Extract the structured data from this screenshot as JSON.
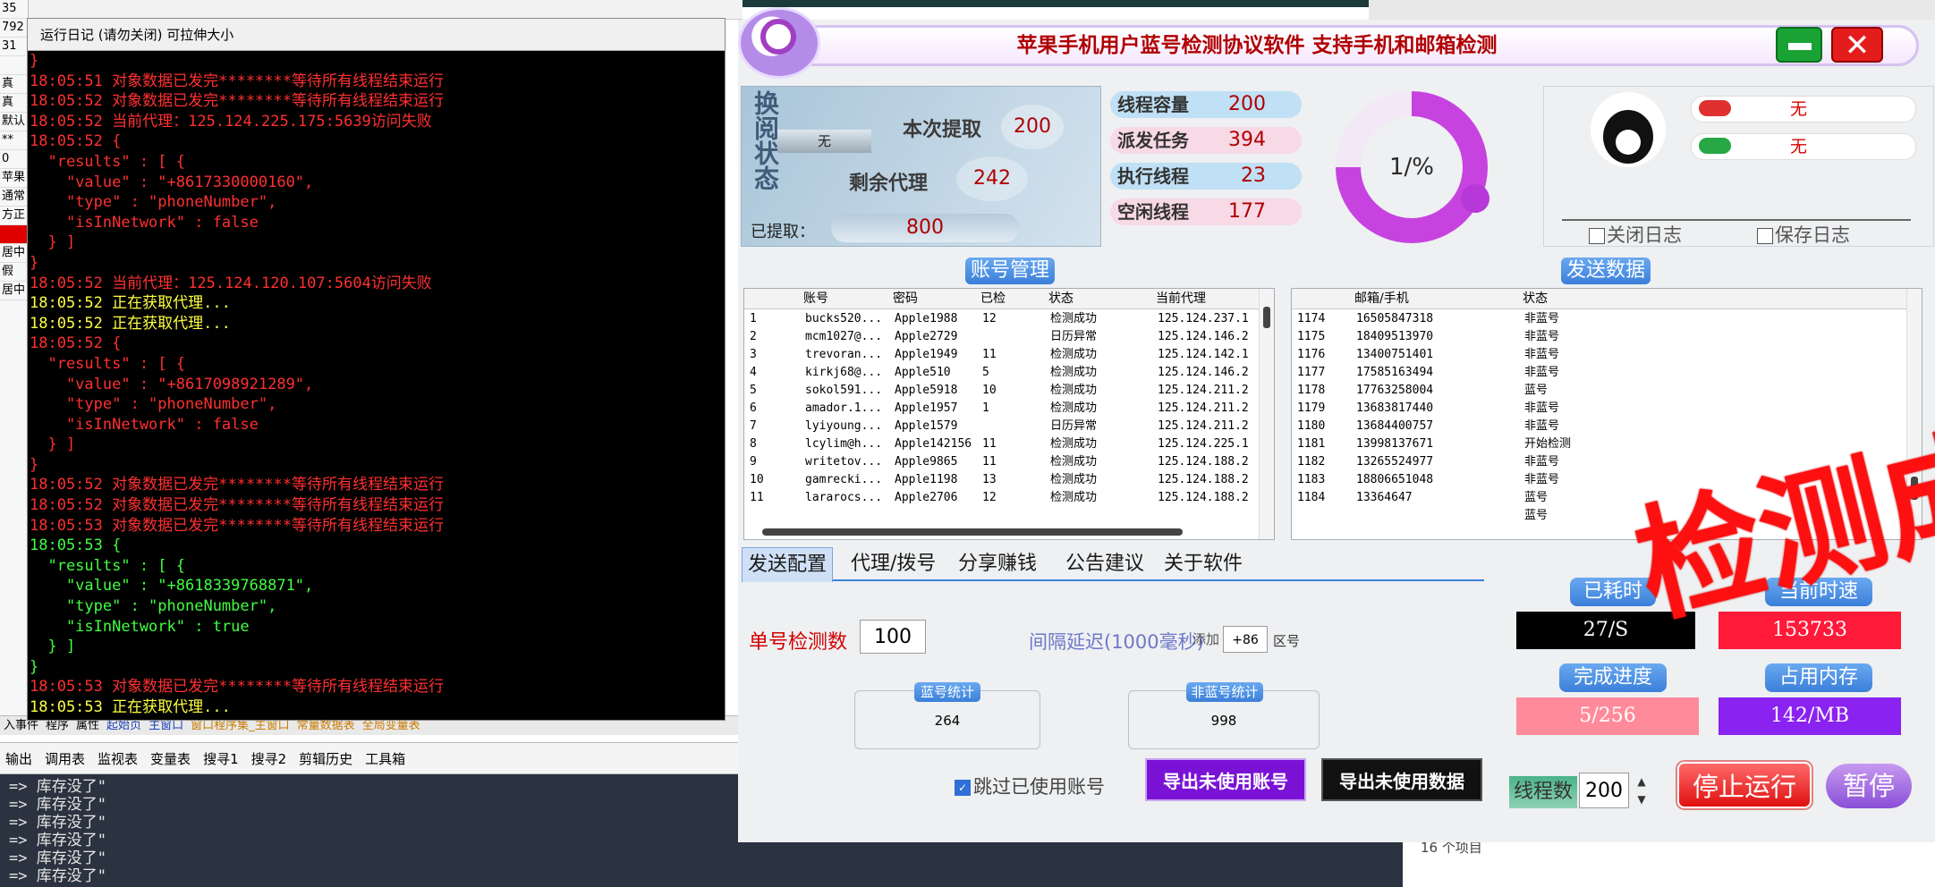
{
  "ide": {
    "left_col": [
      "35",
      "792",
      "31",
      "",
      "真",
      "真",
      "默认",
      "**",
      "0",
      "苹果",
      "通常",
      "方正",
      "",
      "居中",
      "假",
      "居中"
    ],
    "tabs": [
      "入事件",
      "程序",
      "属性",
      "起始页",
      "主窗口",
      "窗口程序集_主窗口",
      "常量数据表",
      "全局变量表"
    ],
    "toolbar": [
      "输出",
      "调用表",
      "监视表",
      "变量表",
      "搜寻1",
      "搜寻2",
      "剪辑历史",
      "工具箱"
    ],
    "output_lines": [
      "=> 库存没了\"",
      "=> 库存没了\"",
      "=> 库存没了\"",
      "=> 库存没了\"",
      "=> 库存没了\"",
      "=> 库存没了\""
    ],
    "file_count": "16 个项目"
  },
  "log_window": {
    "title": "运行日记 (请勿关闭) 可拉伸大小",
    "lines": [
      {
        "text": "}",
        "color": "red"
      },
      {
        "text": "18:05:51 对象数据已发完********等待所有线程结束运行",
        "color": "red"
      },
      {
        "text": "18:05:52 对象数据已发完********等待所有线程结束运行",
        "color": "red"
      },
      {
        "text": "18:05:52 当前代理：125.124.225.175:5639访问失败",
        "color": "red"
      },
      {
        "text": "18:05:52 {",
        "color": "red"
      },
      {
        "text": "  \"results\" : [ {",
        "color": "red"
      },
      {
        "text": "    \"value\" : \"+8617330000160\",",
        "color": "red"
      },
      {
        "text": "    \"type\" : \"phoneNumber\",",
        "color": "red"
      },
      {
        "text": "    \"isInNetwork\" : false",
        "color": "red"
      },
      {
        "text": "  } ]",
        "color": "red"
      },
      {
        "text": "}",
        "color": "red"
      },
      {
        "text": "18:05:52 当前代理：125.124.120.107:5604访问失败",
        "color": "red"
      },
      {
        "text": "18:05:52 正在获取代理...",
        "color": "yellow"
      },
      {
        "text": "18:05:52 正在获取代理...",
        "color": "yellow"
      },
      {
        "text": "18:05:52 {",
        "color": "red"
      },
      {
        "text": "  \"results\" : [ {",
        "color": "red"
      },
      {
        "text": "    \"value\" : \"+8617098921289\",",
        "color": "red"
      },
      {
        "text": "    \"type\" : \"phoneNumber\",",
        "color": "red"
      },
      {
        "text": "    \"isInNetwork\" : false",
        "color": "red"
      },
      {
        "text": "  } ]",
        "color": "red"
      },
      {
        "text": "}",
        "color": "red"
      },
      {
        "text": "18:05:52 对象数据已发完********等待所有线程结束运行",
        "color": "red"
      },
      {
        "text": "18:05:52 对象数据已发完********等待所有线程结束运行",
        "color": "red"
      },
      {
        "text": "18:05:53 对象数据已发完********等待所有线程结束运行",
        "color": "red"
      },
      {
        "text": "18:05:53 {",
        "color": "green"
      },
      {
        "text": "  \"results\" : [ {",
        "color": "green"
      },
      {
        "text": "    \"value\" : \"+8618339768871\",",
        "color": "green"
      },
      {
        "text": "    \"type\" : \"phoneNumber\",",
        "color": "green"
      },
      {
        "text": "    \"isInNetwork\" : true",
        "color": "green"
      },
      {
        "text": "  } ]",
        "color": "green"
      },
      {
        "text": "}",
        "color": "green"
      },
      {
        "text": "18:05:53 对象数据已发完********等待所有线程结束运行",
        "color": "red"
      },
      {
        "text": "18:05:53 正在获取代理...",
        "color": "yellow"
      }
    ]
  },
  "app": {
    "title": "苹果手机用户蓝号检测协议软件 支持手机和邮箱检测",
    "status_vertical": "换阅状态",
    "status_value": "无",
    "fetch_label": "本次提取",
    "fetch_value": "200",
    "proxy_label": "剩余代理",
    "proxy_value": "242",
    "extracted_label": "已提取：",
    "extracted_value": "800",
    "threads": [
      {
        "label": "线程容量",
        "value": "200",
        "color": "#bfe0f5"
      },
      {
        "label": "派发任务",
        "value": "394",
        "color": "#f8d9e6"
      },
      {
        "label": "执行线程",
        "value": "23",
        "color": "#bfe0f5"
      },
      {
        "label": "空闲线程",
        "value": "177",
        "color": "#f8d9e6"
      }
    ],
    "gauge_text": "1/%",
    "gauge_fraction": 0.75,
    "user_rows": [
      {
        "text": "无",
        "icon_color": "#e03030"
      },
      {
        "text": "无",
        "icon_color": "#28a745"
      }
    ],
    "close_log_label": "关闭日志",
    "save_log_label": "保存日志",
    "account_section": "账号管理",
    "send_section": "发送数据",
    "account_table": {
      "headers": [
        "",
        "账号",
        "密码",
        "已检",
        "状态",
        "当前代理"
      ],
      "rows": [
        [
          "1",
          "bucks520...",
          "Apple1988",
          "12",
          "检测成功",
          "125.124.237.1"
        ],
        [
          "2",
          "mcm1027@...",
          "Apple2729",
          "",
          "日历异常",
          "125.124.146.2"
        ],
        [
          "3",
          "trevoran...",
          "Apple1949",
          "11",
          "检测成功",
          "125.124.142.1"
        ],
        [
          "4",
          "kirkj68@...",
          "Apple510",
          "5",
          "检测成功",
          "125.124.146.2"
        ],
        [
          "5",
          "sokol591...",
          "Apple5918",
          "10",
          "检测成功",
          "125.124.211.2"
        ],
        [
          "6",
          "amador.1...",
          "Apple1957",
          "1",
          "检测成功",
          "125.124.211.2"
        ],
        [
          "7",
          "lyiyoung...",
          "Apple1579",
          "",
          "日历异常",
          "125.124.211.2"
        ],
        [
          "8",
          "lcylim@h...",
          "Apple142156",
          "11",
          "检测成功",
          "125.124.225.1"
        ],
        [
          "9",
          "writetov...",
          "Apple9865",
          "11",
          "检测成功",
          "125.124.188.2"
        ],
        [
          "10",
          "gamrecki...",
          "Apple1198",
          "13",
          "检测成功",
          "125.124.188.2"
        ],
        [
          "11",
          "lararocs...",
          "Apple2706",
          "12",
          "检测成功",
          "125.124.188.2"
        ]
      ]
    },
    "send_table": {
      "headers": [
        "",
        "邮箱/手机",
        "状态"
      ],
      "rows": [
        [
          "1174",
          "16505847318",
          "非蓝号"
        ],
        [
          "1175",
          "18409513970",
          "非蓝号"
        ],
        [
          "1176",
          "13400751401",
          "非蓝号"
        ],
        [
          "1177",
          "17585163494",
          "非蓝号"
        ],
        [
          "1178",
          "17763258004",
          "蓝号"
        ],
        [
          "1179",
          "13683817440",
          "非蓝号"
        ],
        [
          "1180",
          "13684400757",
          "非蓝号"
        ],
        [
          "1181",
          "13998137671",
          "开始检测"
        ],
        [
          "1182",
          "13265524977",
          "非蓝号"
        ],
        [
          "1183",
          "18806651048",
          "非蓝号"
        ],
        [
          "1184",
          "13364647",
          "蓝号"
        ],
        [
          "",
          "",
          "蓝号"
        ]
      ]
    },
    "tabs": [
      "发送配置",
      "代理/拨号",
      "分享赚钱",
      "公告建议",
      "关于软件"
    ],
    "single_label": "单号检测数",
    "single_value": "100",
    "interval_label": "间隔延迟(1000毫秒)",
    "prefix_label": "添加",
    "prefix_value": "+86",
    "area_label": "区号",
    "blue_stat_label": "蓝号统计",
    "blue_stat_value": "264",
    "nonblue_stat_label": "非蓝号统计",
    "nonblue_stat_value": "998",
    "skip_label": "跳过已使用账号",
    "export_unused": "导出未使用账号",
    "export_data": "导出未使用数据",
    "elapsed_label": "已耗时",
    "elapsed_value": "27/S",
    "speed_label": "当前时速",
    "speed_value": "153733",
    "progress_label": "完成进度",
    "progress_value": "5/256",
    "memory_label": "占用内存",
    "memory_value": "142/MB",
    "threads_label": "线程数",
    "threads_value": "200",
    "stop_button": "停止运行",
    "pause_button": "暂停",
    "overlay_text": "检测成功"
  }
}
